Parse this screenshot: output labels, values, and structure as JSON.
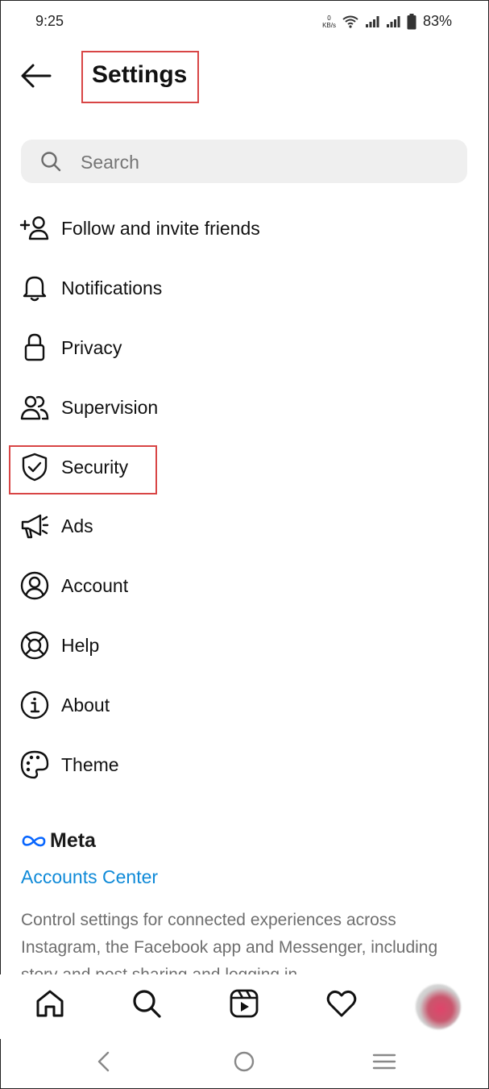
{
  "status_bar": {
    "time": "9:25",
    "net_speed_value": "0",
    "net_speed_unit": "KB/s",
    "battery": "83%"
  },
  "header": {
    "title": "Settings"
  },
  "search": {
    "placeholder": "Search"
  },
  "menu": {
    "items": [
      {
        "label": "Follow and invite friends",
        "icon": "add-person-icon"
      },
      {
        "label": "Notifications",
        "icon": "bell-icon"
      },
      {
        "label": "Privacy",
        "icon": "lock-icon"
      },
      {
        "label": "Supervision",
        "icon": "supervision-people-icon"
      },
      {
        "label": "Security",
        "icon": "shield-check-icon"
      },
      {
        "label": "Ads",
        "icon": "megaphone-icon"
      },
      {
        "label": "Account",
        "icon": "account-circle-icon"
      },
      {
        "label": "Help",
        "icon": "lifebuoy-icon"
      },
      {
        "label": "About",
        "icon": "info-icon"
      },
      {
        "label": "Theme",
        "icon": "palette-icon"
      }
    ]
  },
  "meta": {
    "brand": "Meta",
    "accounts_center": "Accounts Center",
    "description": "Control settings for connected experiences across Instagram, the Facebook app and Messenger, including story and post sharing and logging in."
  },
  "bottom_nav": {
    "items": [
      "home-icon",
      "search-icon",
      "reels-icon",
      "heart-icon",
      "profile-avatar"
    ]
  },
  "system_nav": {
    "items": [
      "back-icon",
      "home-circle-icon",
      "recents-menu-icon"
    ]
  },
  "colors": {
    "highlight_box": "#d84545",
    "link": "#0f8ad8",
    "search_bg": "#efefef",
    "secondary_text": "#6e6e6e"
  }
}
